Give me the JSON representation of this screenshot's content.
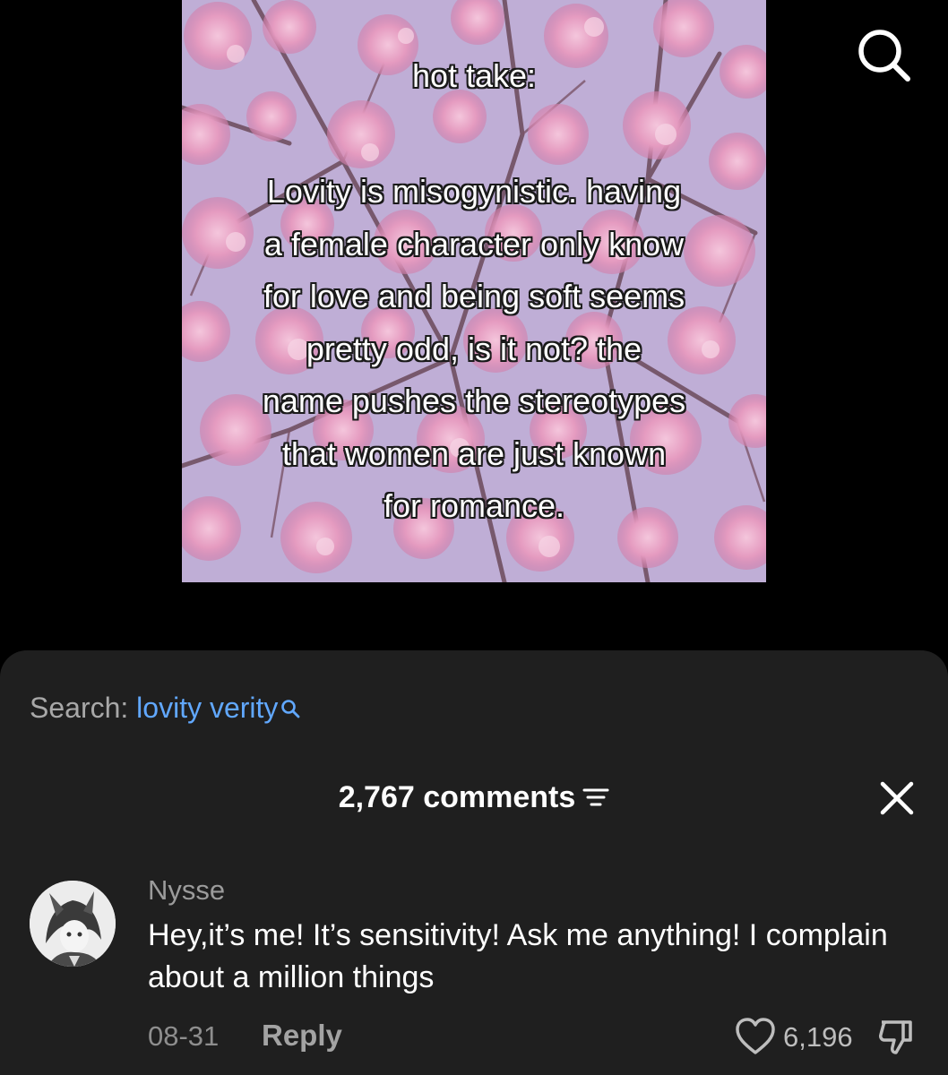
{
  "video": {
    "overlay_title": "hot take:",
    "overlay_lines": [
      "Lovity is misogynistic. having",
      "a female character only know",
      "for love and being soft seems",
      "pretty odd, is it not? the",
      "name pushes the stereotypes",
      "that women are just known",
      "for romance."
    ]
  },
  "top_bar": {
    "search_icon": "search-icon"
  },
  "search_suggestion": {
    "prefix": "Search:",
    "term": "lovity verity",
    "icon": "search-icon"
  },
  "comments": {
    "count_label": "2,767 comments",
    "sort_icon": "sort-icon",
    "close_icon": "close-icon",
    "items": [
      {
        "username": "Nysse",
        "text": "Hey,it’s me! It’s sensitivity! Ask me anything! I complain about a million things",
        "date": "08-31",
        "reply_label": "Reply",
        "likes": "6,196",
        "like_icon": "heart-icon",
        "dislike_icon": "thumbs-down-icon"
      }
    ]
  },
  "colors": {
    "background": "#000000",
    "sheet": "#1f1f1f",
    "link_blue": "#61a8ff",
    "muted_text": "#8e8e8e"
  }
}
